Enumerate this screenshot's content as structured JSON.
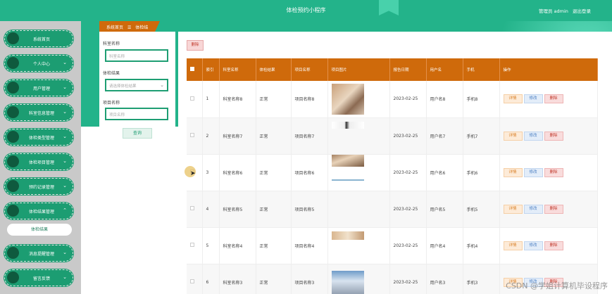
{
  "header": {
    "title": "体检预约小程序",
    "user_label": "管理员 admin",
    "logout_label": "退出登录"
  },
  "sidebar": {
    "items": [
      {
        "label": "系统首页",
        "has_arrow": false
      },
      {
        "label": "个人中心",
        "has_arrow": true,
        "arrow": "⌄"
      },
      {
        "label": "用户管理",
        "has_arrow": true,
        "arrow": "⌄"
      },
      {
        "label": "科室信息管理",
        "has_arrow": true,
        "arrow": "⌄"
      },
      {
        "label": "体检类型管理",
        "has_arrow": true,
        "arrow": "⌄"
      },
      {
        "label": "体检项目管理",
        "has_arrow": true,
        "arrow": "⌄"
      },
      {
        "label": "预约记录管理",
        "has_arrow": true,
        "arrow": "⌄"
      },
      {
        "label": "体检结果管理",
        "has_arrow": true,
        "arrow": "⌃"
      },
      {
        "label": "消息提醒管理",
        "has_arrow": true,
        "arrow": "⌄"
      },
      {
        "label": "留言反馈",
        "has_arrow": true,
        "arrow": "⌄"
      }
    ],
    "submenu_active": "体检结果"
  },
  "breadcrumb": {
    "home": "系统首页",
    "sep": "☰",
    "current": "体检结果"
  },
  "search": {
    "dept_label": "科室名称",
    "dept_placeholder": "科室名称",
    "result_label": "体检结果",
    "result_placeholder": "请选择体检结果",
    "project_label": "项目名称",
    "project_placeholder": "项目名称",
    "search_button": "查询"
  },
  "table": {
    "delete_button": "删除",
    "headers": [
      "",
      "索引",
      "科室名称",
      "体检结果",
      "项目名称",
      "项目图片",
      "报告日期",
      "用户名",
      "手机",
      "操作"
    ],
    "rows": [
      {
        "index": "1",
        "dept": "科室名称8",
        "result": "正常",
        "project": "项目名称8",
        "date": "2023-02-25",
        "user": "用户名8",
        "phone": "手机8",
        "img": "t1"
      },
      {
        "index": "2",
        "dept": "科室名称7",
        "result": "正常",
        "project": "项目名称7",
        "date": "2023-02-25",
        "user": "用户名7",
        "phone": "手机7",
        "img": "t2"
      },
      {
        "index": "3",
        "dept": "科室名称6",
        "result": "正常",
        "project": "项目名称6",
        "date": "2023-02-25",
        "user": "用户名6",
        "phone": "手机6",
        "img": "t3"
      },
      {
        "index": "4",
        "dept": "科室名称5",
        "result": "正常",
        "project": "项目名称5",
        "date": "2023-02-25",
        "user": "用户名5",
        "phone": "手机5",
        "img": "none"
      },
      {
        "index": "5",
        "dept": "科室名称4",
        "result": "正常",
        "project": "项目名称4",
        "date": "2023-02-25",
        "user": "用户名4",
        "phone": "手机4",
        "img": "t4"
      },
      {
        "index": "6",
        "dept": "科室名称3",
        "result": "正常",
        "project": "项目名称3",
        "date": "2023-02-25",
        "user": "用户名3",
        "phone": "手机3",
        "img": "t5"
      }
    ],
    "actions": {
      "detail": "详情",
      "edit": "修改",
      "delete": "删除"
    }
  },
  "watermark": "CSDN @学姐计算机毕设程序",
  "colors": {
    "primary": "#23b38a",
    "accent": "#cf6a0b",
    "menu": "#1c9d72"
  }
}
